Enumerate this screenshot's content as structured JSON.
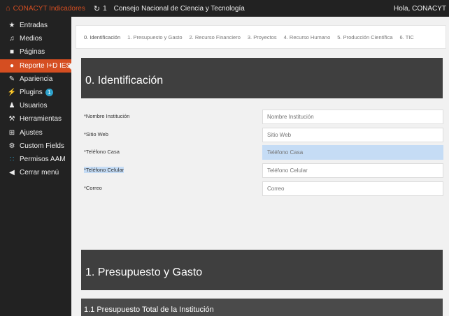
{
  "adminbar": {
    "site_title": "CONACYT Indicadores",
    "updates_count": "1",
    "site_name": "Consejo Nacional de Ciencia y Tecnología",
    "greeting": "Hola, CONACYT"
  },
  "sidebar": {
    "items": [
      {
        "label": "Entradas",
        "icon": "pin-icon"
      },
      {
        "label": "Medios",
        "icon": "media-icon"
      },
      {
        "label": "Páginas",
        "icon": "page-icon"
      },
      {
        "label": "Reporte I+D IES",
        "icon": "report-icon",
        "active": true
      },
      {
        "label": "Apariencia",
        "icon": "brush-icon"
      },
      {
        "label": "Plugins",
        "icon": "plugin-icon",
        "badge": "1"
      },
      {
        "label": "Usuarios",
        "icon": "user-icon"
      },
      {
        "label": "Herramientas",
        "icon": "wrench-icon"
      },
      {
        "label": "Ajustes",
        "icon": "settings-icon"
      },
      {
        "label": "Custom Fields",
        "icon": "gear-icon"
      },
      {
        "label": "Permisos AAM",
        "icon": "grid-icon"
      },
      {
        "label": "Cerrar menú",
        "icon": "collapse-icon"
      }
    ]
  },
  "tabs": [
    "0. Identificación",
    "1. Presupuesto y Gasto",
    "2. Recurso Financiero",
    "3. Proyectos",
    "4. Recurso Humano",
    "5. Producción Científica",
    "6. TIC"
  ],
  "section0": {
    "title": "0. Identificación",
    "fields": [
      {
        "label": "*Nombre Institución",
        "placeholder": "Nombre Institución"
      },
      {
        "label": "*Sitio Web",
        "placeholder": "Sitio Web"
      },
      {
        "label": "*Teléfono Casa",
        "placeholder": "Teléfono Casa"
      },
      {
        "label": "*Teléfono Celular",
        "placeholder": "Teléfono Celular"
      },
      {
        "label": "*Correo",
        "placeholder": "Correo"
      }
    ]
  },
  "section1": {
    "title": "1. Presupuesto y Gasto",
    "subtitle": "1.1 Presupuesto Total de la Institución"
  },
  "colors": {
    "accent": "#d54e21",
    "sidebar_bg": "#222222",
    "panel_bg": "#3f3f3f",
    "selection": "#c5dcf5",
    "badge": "#2ea2cc"
  }
}
